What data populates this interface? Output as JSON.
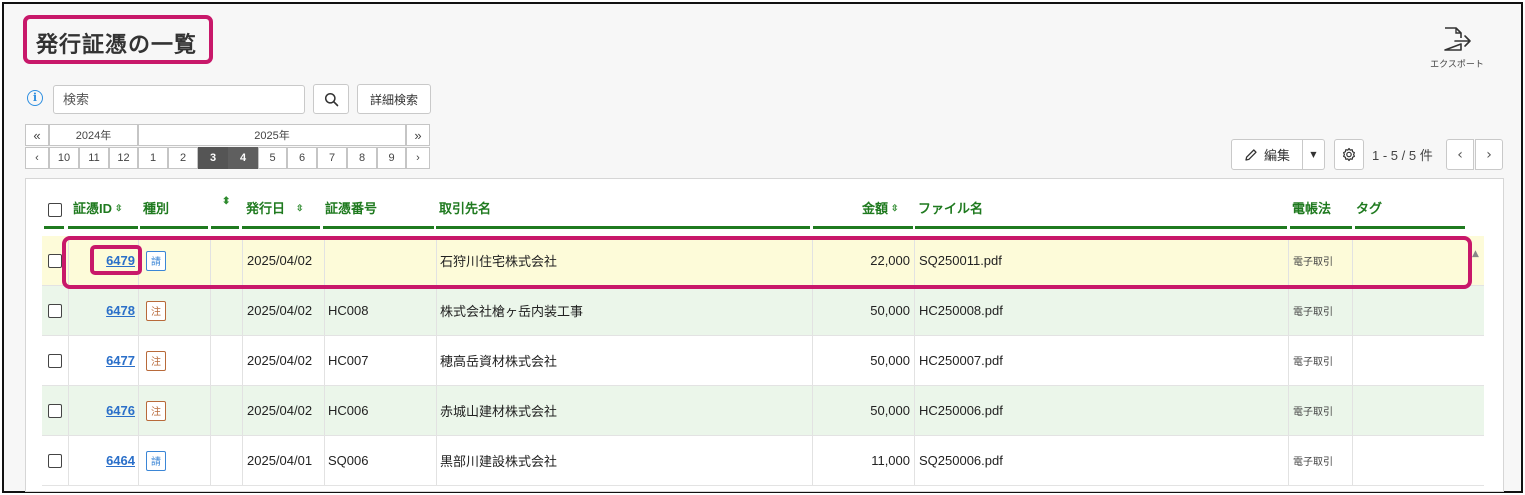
{
  "page": {
    "title": "発行証憑の一覧"
  },
  "export": {
    "label": "エクスポート",
    "icon": "export-icon"
  },
  "search": {
    "placeholder": "検索",
    "value": "",
    "advanced_label": "詳細検索",
    "info_icon": "i"
  },
  "date_nav": {
    "prev_year": "«",
    "next_year": "»",
    "prev_month": "‹",
    "next_month": "›",
    "years": [
      "2024年",
      "2025年"
    ],
    "months_2024": [
      "10",
      "11",
      "12"
    ],
    "months_2025": [
      "1",
      "2",
      "3",
      "4",
      "5",
      "6",
      "7",
      "8",
      "9"
    ],
    "selected_months": [
      "3",
      "4"
    ]
  },
  "toolbar": {
    "edit_label": "編集",
    "page_info": "1 - 5 / 5 件",
    "prev": "‹",
    "next": "›"
  },
  "table": {
    "headers": {
      "id": "証憑ID",
      "kind": "種別",
      "date": "発行日",
      "number": "証憑番号",
      "partner": "取引先名",
      "amount": "金額",
      "file": "ファイル名",
      "edl": "電帳法",
      "tag": "タグ"
    },
    "rows": [
      {
        "id": "6479",
        "kind": "請",
        "kind_type": "request",
        "date": "2025/04/02",
        "number": "",
        "partner": "石狩川住宅株式会社",
        "amount": "22,000",
        "file": "SQ250011.pdf",
        "edl": "電子取引",
        "tag": ""
      },
      {
        "id": "6478",
        "kind": "注",
        "kind_type": "order",
        "date": "2025/04/02",
        "number": "HC008",
        "partner": "株式会社槍ヶ岳内装工事",
        "amount": "50,000",
        "file": "HC250008.pdf",
        "edl": "電子取引",
        "tag": ""
      },
      {
        "id": "6477",
        "kind": "注",
        "kind_type": "order",
        "date": "2025/04/02",
        "number": "HC007",
        "partner": "穂高岳資材株式会社",
        "amount": "50,000",
        "file": "HC250007.pdf",
        "edl": "電子取引",
        "tag": ""
      },
      {
        "id": "6476",
        "kind": "注",
        "kind_type": "order",
        "date": "2025/04/02",
        "number": "HC006",
        "partner": "赤城山建材株式会社",
        "amount": "50,000",
        "file": "HC250006.pdf",
        "edl": "電子取引",
        "tag": ""
      },
      {
        "id": "6464",
        "kind": "請",
        "kind_type": "request",
        "date": "2025/04/01",
        "number": "SQ006",
        "partner": "黒部川建設株式会社",
        "amount": "11,000",
        "file": "SQ250006.pdf",
        "edl": "電子取引",
        "tag": ""
      }
    ]
  },
  "colors": {
    "accent_highlight": "#c8186a",
    "header_green": "#1f7a1f",
    "row_yellow": "#fdfbd9",
    "row_green": "#ebf6ea",
    "link_blue": "#2a6fc9"
  }
}
